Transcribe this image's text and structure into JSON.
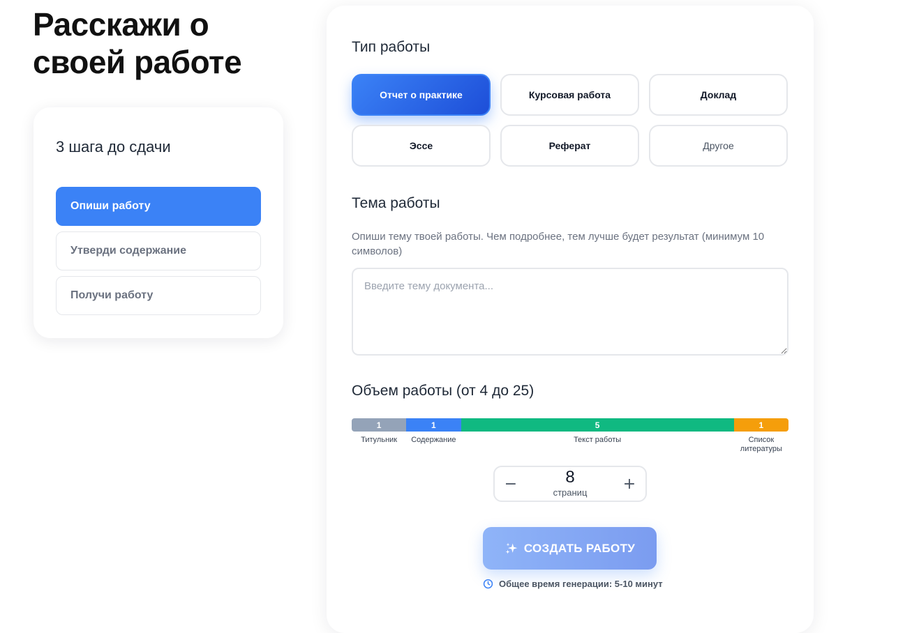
{
  "page": {
    "title": "Расскажи о своей работе"
  },
  "steps": {
    "title": "3 шага до сдачи",
    "items": [
      {
        "label": "Опиши работу",
        "active": true
      },
      {
        "label": "Утверди содержание",
        "active": false
      },
      {
        "label": "Получи работу",
        "active": false
      }
    ]
  },
  "work_type": {
    "title": "Тип работы",
    "selected": "Отчет о практике",
    "options": [
      "Отчет о практике",
      "Курсовая работа",
      "Доклад",
      "Эссе",
      "Реферат",
      "Другое"
    ]
  },
  "topic": {
    "title": "Тема работы",
    "hint": "Опиши тему твоей работы. Чем подробнее, тем лучше будет результат (минимум 10 символов)",
    "value": "",
    "placeholder": "Введите тему документа..."
  },
  "volume": {
    "title": "Объем работы (от 4 до 25)",
    "segments": [
      {
        "label": "Титульник",
        "pages": "1",
        "color": "#94a3b8"
      },
      {
        "label": "Содержание",
        "pages": "1",
        "color": "#3b82f6"
      },
      {
        "label": "Текст работы",
        "pages": "5",
        "color": "#10b981"
      },
      {
        "label": "Список литературы",
        "pages": "1",
        "color": "#f59e0b"
      }
    ],
    "pages": "8",
    "unit": "страниц",
    "decrement_symbol": "−",
    "increment_symbol": "+"
  },
  "create": {
    "label": "СОЗДАТЬ РАБОТУ",
    "generation_time": "Общее время генерации: 5-10 минут"
  },
  "icons": {
    "button_icon": "sparkles-icon",
    "time_icon": "clock-icon"
  },
  "colors": {
    "accent": "#3b82f6",
    "accent_dark": "#1d4ed8"
  }
}
